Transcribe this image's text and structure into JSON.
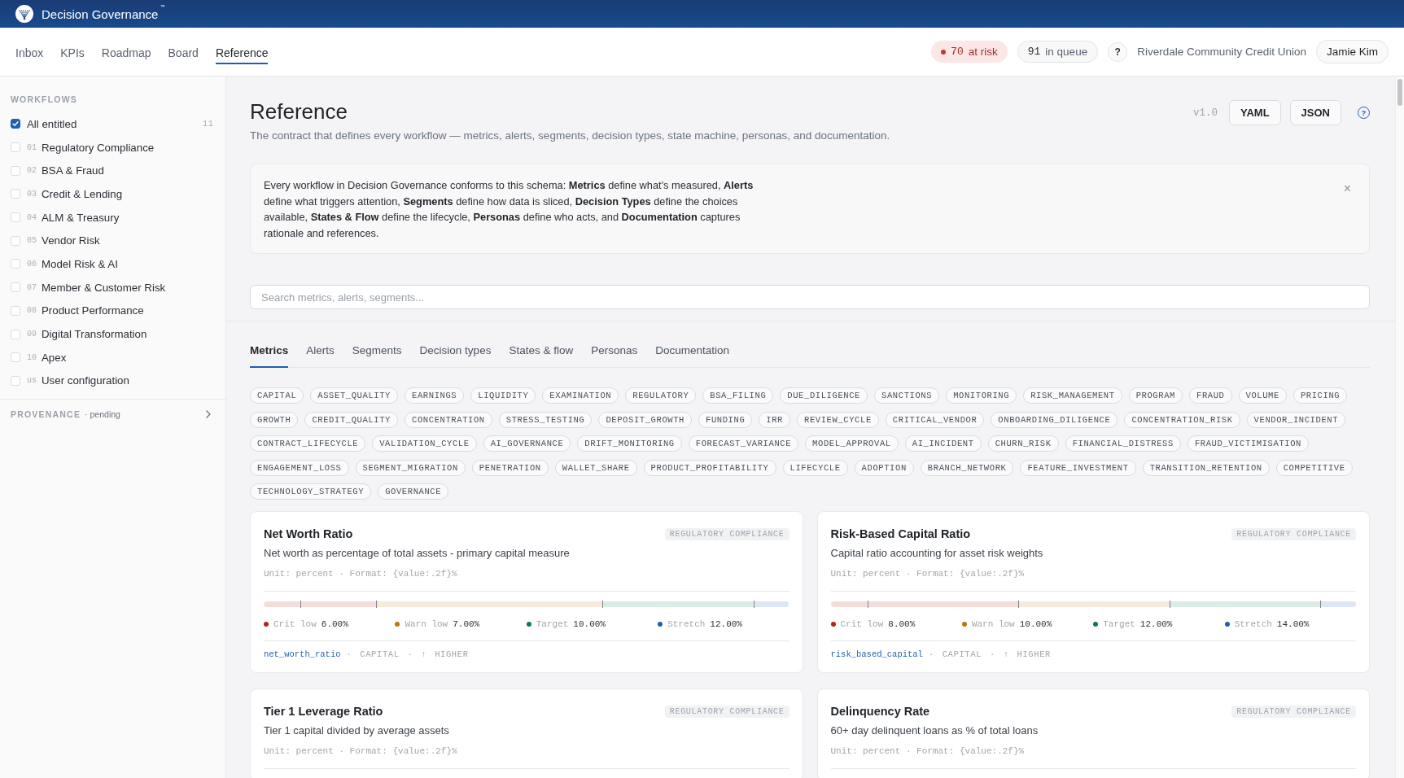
{
  "app_bar": {
    "brand": "Decision Governance$^{™}$"
  },
  "nav": {
    "tabs": [
      {
        "label": "Inbox",
        "selected": false
      },
      {
        "label": "KPIs",
        "selected": false
      },
      {
        "label": "Roadmap",
        "selected": false
      },
      {
        "label": "Board",
        "selected": false
      },
      {
        "label": "Reference",
        "selected": true
      }
    ],
    "at_risk": {
      "count": "70",
      "label": "at risk"
    },
    "queue": {
      "count": "91",
      "label": "in queue"
    },
    "help": "?",
    "organization": "Riverdale Community Credit Union",
    "user": "Jamie Kim"
  },
  "sidebar": {
    "heading": "WORKFLOWS",
    "items": [
      {
        "label": "All entitled",
        "count": "11",
        "checked": true
      },
      {
        "number": "01",
        "label": "Regulatory Compliance",
        "checked": false
      },
      {
        "number": "02",
        "label": "BSA & Fraud",
        "checked": false
      },
      {
        "number": "03",
        "label": "Credit & Lending",
        "checked": false
      },
      {
        "number": "04",
        "label": "ALM & Treasury",
        "checked": false
      },
      {
        "number": "05",
        "label": "Vendor Risk",
        "checked": false
      },
      {
        "number": "06",
        "label": "Model Risk & AI",
        "checked": false
      },
      {
        "number": "07",
        "label": "Member & Customer Risk",
        "checked": false
      },
      {
        "number": "08",
        "label": "Product Performance",
        "checked": false
      },
      {
        "number": "09",
        "label": "Digital Transformation",
        "checked": false
      },
      {
        "number": "10",
        "label": "Apex",
        "checked": false
      },
      {
        "number": "us",
        "label": "User configuration",
        "checked": false
      }
    ],
    "provenance": {
      "label": "PROVENANCE",
      "status": "· pending"
    }
  },
  "page": {
    "title": "Reference",
    "subtitle": "The contract that defines every workflow — metrics, alerts, segments, decision types, state machine, personas, and documentation.",
    "version": "v1.0",
    "buttons": [
      "YAML",
      "JSON"
    ],
    "help": "?",
    "notice": {
      "text": "Every workflow in Decision Governance conforms to this schema: **Metrics** define what's measured, **Alerts** define what triggers attention, **Segments** define how data is sliced, **Decision Types** define the choices available, **States & Flow** define the lifecycle, **Personas** define who acts, and **Documentation** captures rationale and references.",
      "close": "×"
    },
    "search": {
      "placeholder": "Search metrics, alerts, segments..."
    },
    "tabs": [
      {
        "label": "Metrics",
        "selected": true
      },
      {
        "label": "Alerts",
        "selected": false
      },
      {
        "label": "Segments",
        "selected": false
      },
      {
        "label": "Decision types",
        "selected": false
      },
      {
        "label": "States & flow",
        "selected": false
      },
      {
        "label": "Personas",
        "selected": false
      },
      {
        "label": "Documentation",
        "selected": false
      }
    ],
    "tags": [
      "CAPITAL",
      "ASSET_QUALITY",
      "EARNINGS",
      "LIQUIDITY",
      "EXAMINATION",
      "REGULATORY",
      "BSA_FILING",
      "DUE_DILIGENCE",
      "SANCTIONS",
      "MONITORING",
      "RISK_MANAGEMENT",
      "PROGRAM",
      "FRAUD",
      "VOLUME",
      "PRICING",
      "GROWTH",
      "CREDIT_QUALITY",
      "CONCENTRATION",
      "STRESS_TESTING",
      "DEPOSIT_GROWTH",
      "FUNDING",
      "IRR",
      "REVIEW_CYCLE",
      "CRITICAL_VENDOR",
      "ONBOARDING_DILIGENCE",
      "CONCENTRATION_RISK",
      "VENDOR_INCIDENT",
      "CONTRACT_LIFECYCLE",
      "VALIDATION_CYCLE",
      "AI_GOVERNANCE",
      "DRIFT_MONITORING",
      "FORECAST_VARIANCE",
      "MODEL_APPROVAL",
      "AI_INCIDENT",
      "CHURN_RISK",
      "FINANCIAL_DISTRESS",
      "FRAUD_VICTIMISATION",
      "ENGAGEMENT_LOSS",
      "SEGMENT_MIGRATION",
      "PENETRATION",
      "WALLET_SHARE",
      "PRODUCT_PROFITABILITY",
      "LIFECYCLE",
      "ADOPTION",
      "BRANCH_NETWORK",
      "FEATURE_INVESTMENT",
      "TRANSITION_RETENTION",
      "COMPETITIVE",
      "TECHNOLOGY_STRATEGY",
      "GOVERNANCE"
    ],
    "metrics": [
      {
        "title": "Net Worth Ratio",
        "workflow": "REGULATORY COMPLIANCE",
        "description": "Net worth as percentage of total assets - primary capital measure",
        "format": "Unit: percent · Format: {value:.2f}%",
        "thresholds": [
          {
            "label": "Crit low",
            "value": "6.00%",
            "color": "#b42318",
            "level": 0.07
          },
          {
            "label": "Warn low",
            "value": "7.00%",
            "color": "#c27112",
            "level": 0.214
          },
          {
            "label": "Target",
            "value": "10.00%",
            "color": "#0e7a55",
            "level": 0.645
          },
          {
            "label": "Stretch",
            "value": "12.00%",
            "color": "#1f5fb0",
            "level": 0.932
          }
        ],
        "key": "net_worth_ratio",
        "meta": "· CAPITAL · ↑ HIGHER"
      },
      {
        "title": "Risk-Based Capital Ratio",
        "workflow": "REGULATORY COMPLIANCE",
        "description": "Capital ratio accounting for asset risk weights",
        "format": "Unit: percent · Format: {value:.2f}%",
        "thresholds": [
          {
            "label": "Crit low",
            "value": "8.00%",
            "color": "#b42318",
            "level": 0.07
          },
          {
            "label": "Warn low",
            "value": "10.00%",
            "color": "#c27112",
            "level": 0.357
          },
          {
            "label": "Target",
            "value": "12.00%",
            "color": "#0e7a55",
            "level": 0.645
          },
          {
            "label": "Stretch",
            "value": "14.00%",
            "color": "#1f5fb0",
            "level": 0.932
          }
        ],
        "key": "risk_based_capital",
        "meta": "· CAPITAL · ↑ HIGHER"
      },
      {
        "title": "Tier 1 Leverage Ratio",
        "workflow": "REGULATORY COMPLIANCE",
        "description": "Tier 1 capital divided by average assets",
        "format": "Unit: percent · Format: {value:.2f}%"
      },
      {
        "title": "Delinquency Rate",
        "workflow": "REGULATORY COMPLIANCE",
        "description": "60+ day delinquent loans as % of total loans",
        "format": "Unit: percent · Format: {value:.2f}%"
      }
    ]
  }
}
